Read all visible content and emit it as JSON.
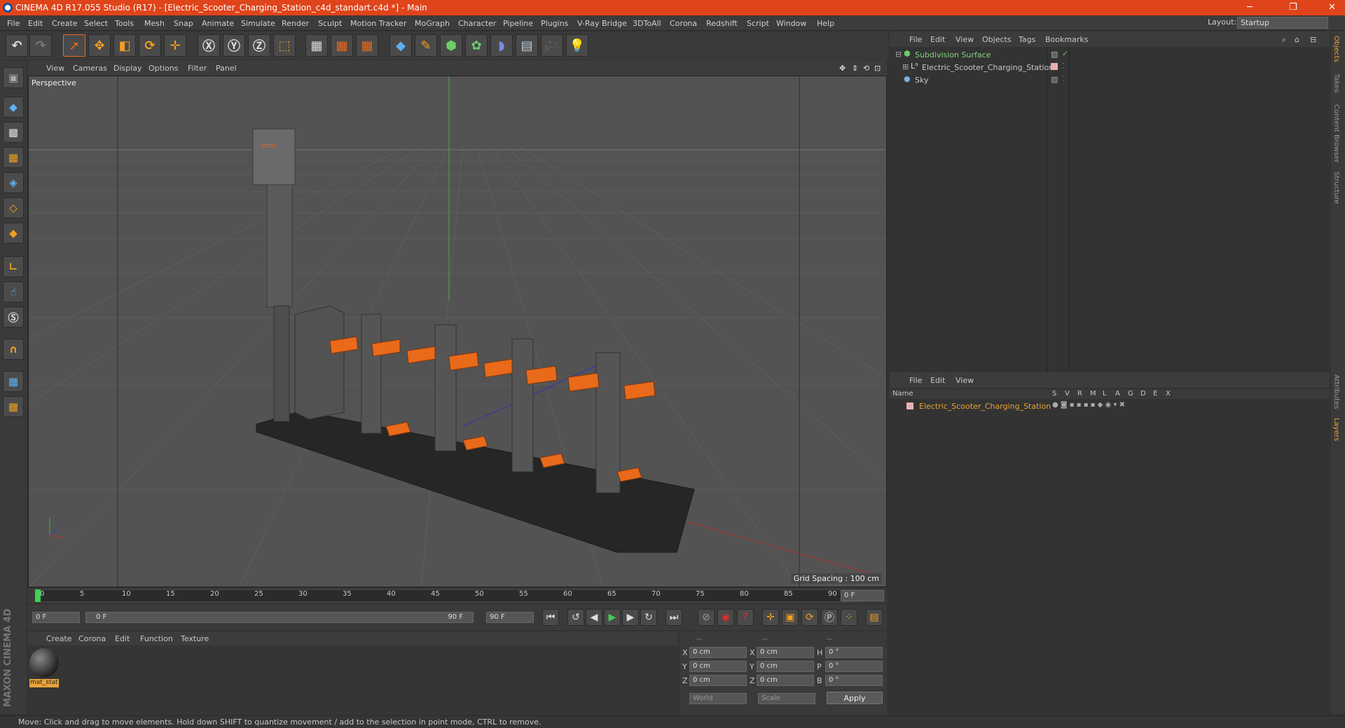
{
  "window": {
    "title": "CINEMA 4D R17.055 Studio (R17) - [Electric_Scooter_Charging_Station_c4d_standart.c4d *] - Main"
  },
  "menubar": {
    "items": [
      "File",
      "Edit",
      "Create",
      "Select",
      "Tools",
      "Mesh",
      "Snap",
      "Animate",
      "Simulate",
      "Render",
      "Sculpt",
      "Motion Tracker",
      "MoGraph",
      "Character",
      "Pipeline",
      "Plugins",
      "V-Ray Bridge",
      "3DToAll",
      "Corona",
      "Redshift",
      "Script",
      "Window",
      "Help"
    ],
    "layout_label": "Layout:",
    "layout_value": "Startup"
  },
  "viewport": {
    "menu": [
      "View",
      "Cameras",
      "Display",
      "Options",
      "Filter",
      "Panel"
    ],
    "camera": "Perspective",
    "grid_spacing": "Grid Spacing : 100 cm"
  },
  "timeline": {
    "ticks": [
      "0",
      "5",
      "10",
      "15",
      "20",
      "25",
      "30",
      "35",
      "40",
      "45",
      "50",
      "55",
      "60",
      "65",
      "70",
      "75",
      "80",
      "85",
      "90"
    ],
    "current_frame": "0 F"
  },
  "transport": {
    "start": "0 F",
    "range_start": "0 F",
    "range_end": "90 F",
    "end": "90 F"
  },
  "material_menu": [
    "Create",
    "Corona",
    "Edit",
    "Function",
    "Texture"
  ],
  "material": {
    "name": "mat_stat"
  },
  "coords": {
    "headers": [
      "--",
      "--",
      "--"
    ],
    "rows": [
      {
        "a": "X",
        "av": "0 cm",
        "b": "X",
        "bv": "0 cm",
        "c": "H",
        "cv": "0 °"
      },
      {
        "a": "Y",
        "av": "0 cm",
        "b": "Y",
        "bv": "0 cm",
        "c": "P",
        "cv": "0 °"
      },
      {
        "a": "Z",
        "av": "0 cm",
        "b": "Z",
        "bv": "0 cm",
        "c": "B",
        "cv": "0 °"
      }
    ],
    "world": "World",
    "scale": "Scale",
    "apply": "Apply"
  },
  "status": "Move: Click and drag to move elements. Hold down SHIFT to quantize movement / add to the selection in point mode, CTRL to remove.",
  "objects": {
    "menu": [
      "File",
      "Edit",
      "View",
      "Objects",
      "Tags",
      "Bookmarks"
    ],
    "items": [
      {
        "name": "Subdivision Surface",
        "color": "#7fd67f"
      },
      {
        "name": "Electric_Scooter_Charging_Station",
        "color": "#c8c8c8"
      },
      {
        "name": "Sky",
        "color": "#c8c8c8"
      }
    ]
  },
  "layers": {
    "menu": [
      "File",
      "Edit",
      "View"
    ],
    "columns": [
      "Name",
      "S",
      "V",
      "R",
      "M",
      "L",
      "A",
      "G",
      "D",
      "E",
      "X"
    ],
    "items": [
      {
        "name": "Electric_Scooter_Charging_Station",
        "color": "#e8a23a"
      }
    ]
  },
  "right_tabs": [
    "Objects",
    "Takes",
    "Content Browser",
    "Structure",
    "Attributes",
    "Layers"
  ],
  "brand": "MAXON CINEMA 4D",
  "colors": {
    "titlebar": "#e0441a",
    "accent_orange": "#e86a1a",
    "grid": "#5d5d5d"
  }
}
